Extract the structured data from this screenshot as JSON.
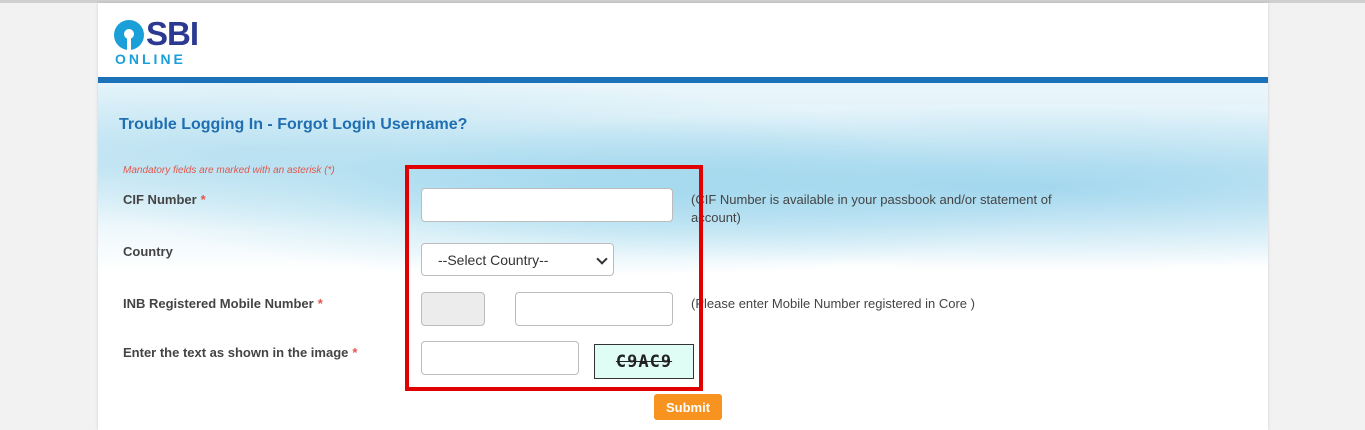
{
  "logo": {
    "brand": "SBI",
    "tagline": "ONLINE"
  },
  "form": {
    "title": "Trouble Logging In - Forgot Login Username?",
    "mandatory_note": "Mandatory fields are marked with an asterisk (*)",
    "required_marker": "*",
    "cif": {
      "label": "CIF Number",
      "value": "",
      "hint": "(CIF Number is available in your passbook and/or statement of account)"
    },
    "country": {
      "label": "Country",
      "selected": "--Select Country--"
    },
    "mobile": {
      "label": "INB Registered Mobile Number",
      "code_value": "",
      "number_value": "",
      "hint": "(Please enter Mobile Number registered in Core )"
    },
    "captcha": {
      "label": "Enter the text as shown in the image",
      "value": "",
      "image_text": "C9AC9"
    },
    "submit_label": "Submit"
  },
  "colors": {
    "brand_blue": "#2b3990",
    "accent_blue": "#1a9fd9",
    "bar_blue": "#1c72b8",
    "required_red": "#e2574c",
    "submit_orange": "#f7931e",
    "highlight_red": "#e00000"
  }
}
